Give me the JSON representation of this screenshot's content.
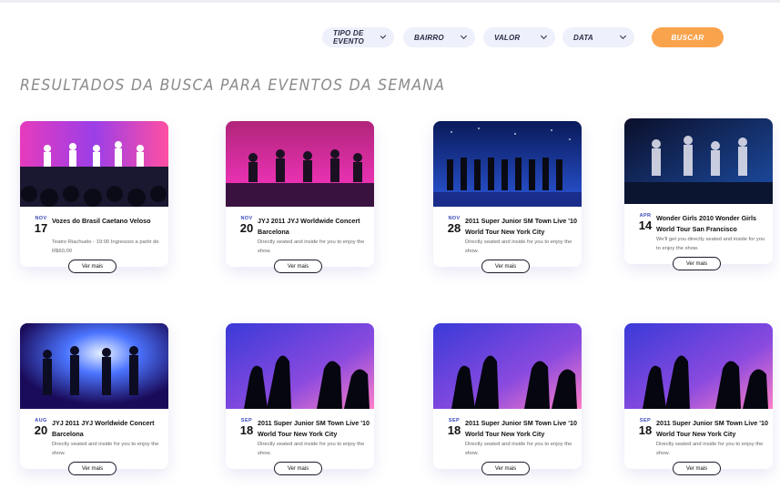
{
  "filters": {
    "items": [
      {
        "label": "TIPO DE EVENTO"
      },
      {
        "label": "BAIRRO"
      },
      {
        "label": "VALOR"
      },
      {
        "label": "DATA"
      }
    ],
    "search_label": "BUSCAR"
  },
  "heading": "RESULTADOS DA BUSCA PARA EVENTOS DA SEMANA",
  "more_label": "Ver mais",
  "cards": [
    {
      "month": "NOV",
      "day": "17",
      "title": "Vozes do Brasil Caetano Veloso",
      "desc": "Teatro Riachuelo - 19:00 Ingressos a partir de R$60,00",
      "image": "stage-colorful-performers"
    },
    {
      "month": "NOV",
      "day": "20",
      "title": "JYJ 2011 JYJ Worldwide Concert Barcelona",
      "desc": "Directly seated and inside for you to enjoy the show.",
      "image": "stage-pink-dancers"
    },
    {
      "month": "NOV",
      "day": "28",
      "title": "2011 Super Junior SM Town Live '10 World Tour New York City",
      "desc": "Directly seated and inside for you to enjoy the show.",
      "image": "stage-blue-group"
    },
    {
      "month": "APR",
      "day": "14",
      "title": "Wonder Girls 2010 Wonder Girls World Tour San Francisco",
      "desc": "We'll get you directly seated and inside for you to enjoy the show.",
      "image": "stage-dark-dancers"
    },
    {
      "month": "AUG",
      "day": "20",
      "title": "JYJ 2011 JYJ Worldwide Concert Barcelona",
      "desc": "Directly seated and inside for you to enjoy the show.",
      "image": "stage-blue-light-dancers"
    },
    {
      "month": "SEP",
      "day": "18",
      "title": "2011 Super Junior SM Town Live '10 World Tour New York City",
      "desc": "Directly seated and inside for you to enjoy the show.",
      "image": "crowd-finger-hearts"
    },
    {
      "month": "SEP",
      "day": "18",
      "title": "2011 Super Junior SM Town Live '10 World Tour New York City",
      "desc": "Directly seated and inside for you to enjoy the show.",
      "image": "crowd-finger-hearts"
    },
    {
      "month": "SEP",
      "day": "18",
      "title": "2011 Super Junior SM Town Live '10 World Tour New York City",
      "desc": "Directly seated and inside for you to enjoy the show.",
      "image": "crowd-finger-hearts"
    }
  ]
}
